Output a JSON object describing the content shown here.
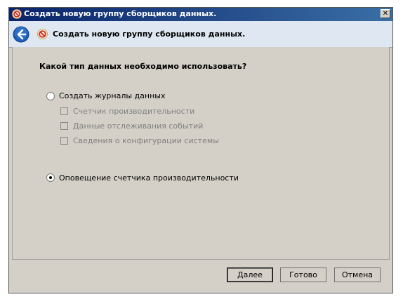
{
  "window": {
    "title": "Создать новую группу сборщиков данных.",
    "close_glyph": "✕"
  },
  "header": {
    "title": "Создать новую группу сборщиков данных.",
    "back_icon": "back-arrow-icon",
    "wizard_icon": "no-sign-icon"
  },
  "main": {
    "question": "Какой тип данных необходимо использовать?",
    "options": [
      {
        "label": "Создать журналы данных",
        "selected": false,
        "suboptions": [
          {
            "label": "Счетчик производительности",
            "checked": false,
            "enabled": false
          },
          {
            "label": "Данные отслеживания событий",
            "checked": false,
            "enabled": false
          },
          {
            "label": "Сведения о конфигурации системы",
            "checked": false,
            "enabled": false
          }
        ]
      },
      {
        "label": "Оповещение счетчика производительности",
        "selected": true
      }
    ]
  },
  "footer": {
    "next_label": "Далее",
    "finish_label": "Готово",
    "cancel_label": "Отмена"
  },
  "colors": {
    "titlebar": "#0a246a",
    "header_bg": "#dfe8f2",
    "window_bg": "#d4d0c8",
    "disabled_text": "#808080",
    "back_button": "#1c5fb8"
  }
}
